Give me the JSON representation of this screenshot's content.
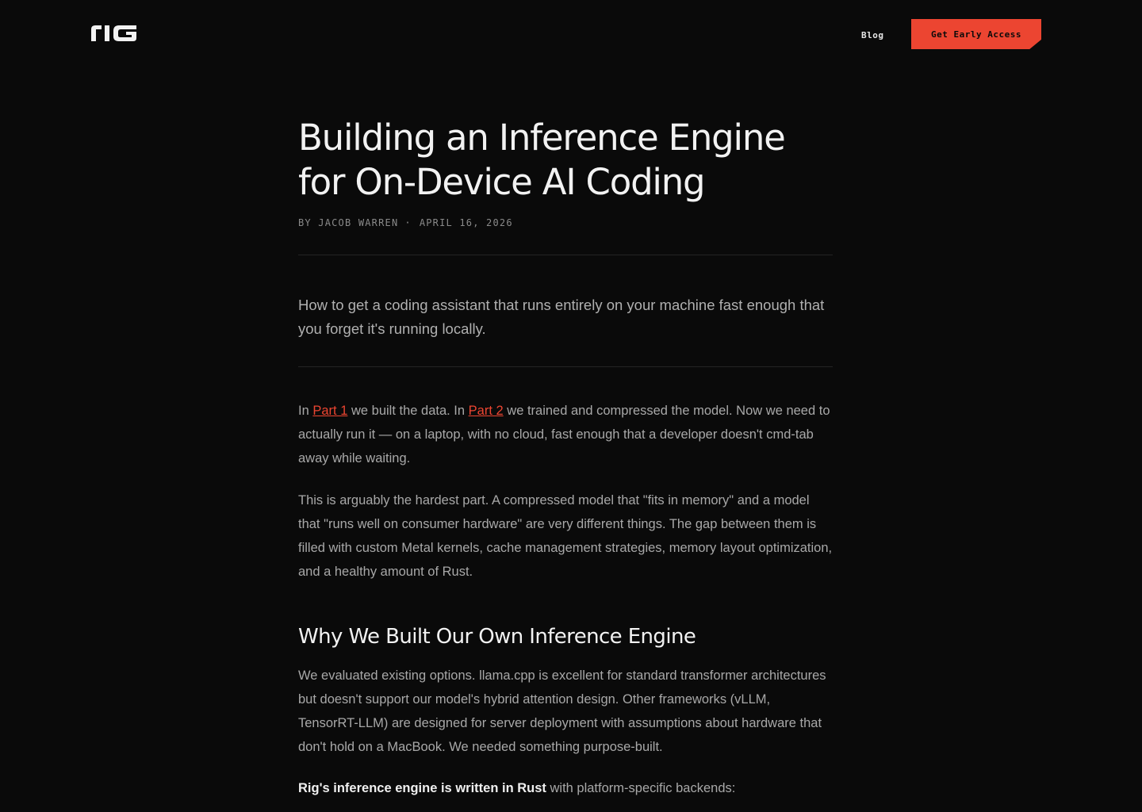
{
  "header": {
    "logo_text": "rIG",
    "nav_blog": "Blog",
    "cta_label": "Get Early Access"
  },
  "article": {
    "title": "Building an Inference Engine for On-Device AI Coding",
    "byline": "BY JACOB WARREN",
    "meta_separator": "·",
    "date": "APRIL 16, 2026",
    "lede": "How to get a coding assistant that runs entirely on your machine fast enough that you forget it's running locally.",
    "p1": {
      "t1": "In ",
      "link1": "Part 1",
      "t2": " we built the data. In ",
      "link2": "Part 2",
      "t3": " we trained and compressed the model. Now we need to actually run it — on a laptop, with no cloud, fast enough that a developer doesn't cmd-tab away while waiting."
    },
    "p2": "This is arguably the hardest part. A compressed model that \"fits in memory\" and a model that \"runs well on consumer hardware\" are very different things. The gap between them is filled with custom Metal kernels, cache management strategies, memory layout optimization, and a healthy amount of Rust.",
    "section_heading": "Why We Built Our Own Inference Engine",
    "p3": "We evaluated existing options. llama.cpp is excellent for standard transformer architectures but doesn't support our model's hybrid attention design. Other frameworks (vLLM, TensorRT-LLM) are designed for server deployment with assumptions about hardware that don't hold on a MacBook. We needed something purpose-built.",
    "p4": {
      "strong": "Rig's inference engine is written in Rust",
      "rest": " with platform-specific backends:"
    }
  },
  "colors": {
    "background": "#0a0a0a",
    "accent": "#ec4531",
    "heading": "#f2f2f2",
    "body": "#a8a8a8"
  }
}
